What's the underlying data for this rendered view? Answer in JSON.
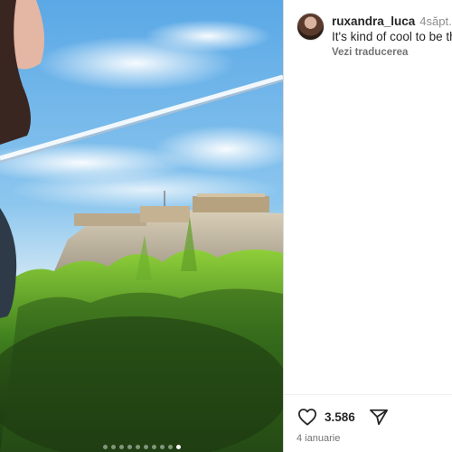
{
  "post": {
    "photo_alt": "",
    "carousel": {
      "total": 10,
      "active_index": 9
    }
  },
  "comment": {
    "username": "ruxandra_luca",
    "time": "4săpt.",
    "text": "It's kind of cool to be th",
    "translate_label": "Vezi traducerea",
    "avatar_icon": "user-avatar"
  },
  "actions": {
    "like_icon": "heart-icon",
    "likes_count": "3.586",
    "share_icon": "paper-plane-icon",
    "date": "4 ianuarie"
  },
  "colors": {
    "text": "#262626",
    "muted": "#737373",
    "divider": "#dbdbdb",
    "sky": "#6fb3e8"
  }
}
